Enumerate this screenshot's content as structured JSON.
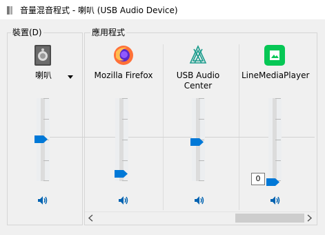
{
  "window": {
    "title": "音量混音程式 - 喇叭 (USB Audio Device)"
  },
  "device_group": {
    "legend": "裝置(D)",
    "device_name": "喇叭",
    "dropdown_icon": "chevron-down-icon"
  },
  "apps_group": {
    "legend": "應用程式",
    "apps": [
      {
        "name": "Mozilla Firefox",
        "icon": "firefox-icon"
      },
      {
        "name": "USB Audio Center",
        "icon": "usb-audio-center-icon"
      },
      {
        "name": "LineMediaPlayer",
        "icon": "line-media-player-icon"
      }
    ]
  },
  "volume_levels": {
    "device": 0.5,
    "firefox": 0.1,
    "usb_audio_center": 0.5,
    "linemediaplayer": 0.0
  },
  "value_tooltip": "0",
  "colors": {
    "accent": "#0078d7",
    "line_green": "#06c755",
    "firefox_orange": "#ff7139"
  }
}
